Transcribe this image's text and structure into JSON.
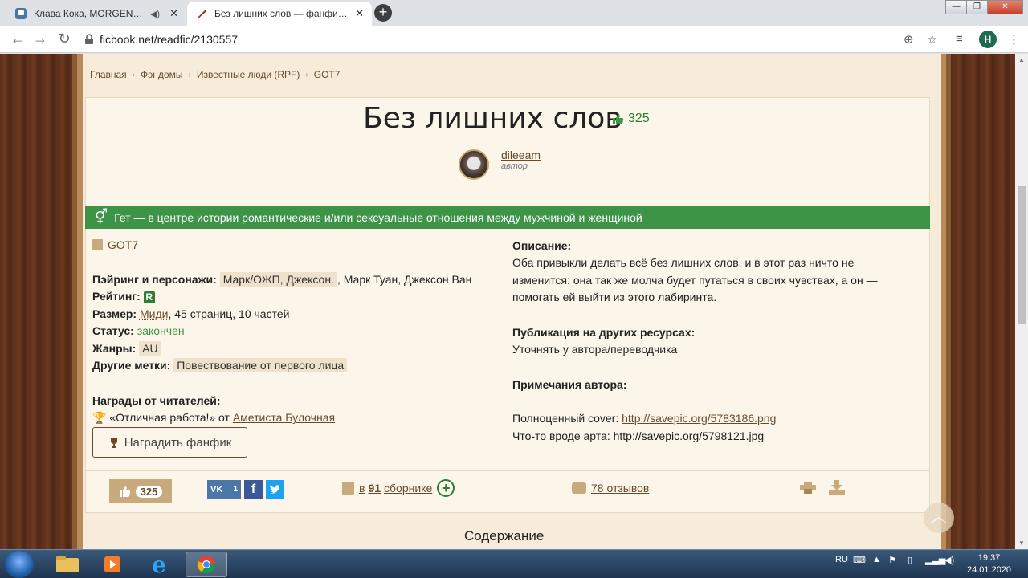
{
  "browser": {
    "tabs": [
      {
        "title": "Клава Кока, MORGENSHTERN",
        "active": false
      },
      {
        "title": "Без лишних слов — фанфик по",
        "active": true
      }
    ],
    "url": "ficbook.net/readfic/2130557",
    "profile_initial": "H"
  },
  "breadcrumbs": [
    "Главная",
    "Фэндомы",
    "Известные люди (RPF)",
    "GOT7"
  ],
  "fic": {
    "title": "Без лишних слов",
    "likes": "325",
    "author": {
      "name": "dileeam",
      "role": "автор"
    },
    "direction": "Гет — в центре истории романтические и/или сексуальные отношения между мужчиной и женщиной",
    "fandom": "GOT7",
    "pairing_label": "Пэйринг и персонажи:",
    "pairing_tag": "Марк/ОЖП, Джексон.",
    "pairing_rest": ", Марк Туан, Джексон Ван",
    "rating_label": "Рейтинг:",
    "rating": "R",
    "size_label": "Размер:",
    "size_link": "Миди",
    "size_rest": ", 45 страниц, 10 частей",
    "status_label": "Статус:",
    "status": "закончен",
    "genres_label": "Жанры:",
    "genre": "AU",
    "tags_label": "Другие метки:",
    "tag": "Повествование от первого лица",
    "awards_label": "Награды от читателей:",
    "award_text": "«Отличная работа!» от",
    "award_from": "Аметиста Булочная",
    "award_button": "Наградить фанфик",
    "description_label": "Описание:",
    "description": "Оба привыкли делать всё без лишних слов, и в этот раз ничто не изменится: она так же молча будет путаться в своих чувствах, а он — помогать ей выйти из этого лабиринта.",
    "publication_label": "Публикация на других ресурсах:",
    "publication": "Уточнять у автора/переводчика",
    "notes_label": "Примечания автора:",
    "notes_cover_label": "Полноценный cover:",
    "notes_cover_link": "http://savepic.org/5783186.png",
    "notes_art": "Что-то вроде арта: http://savepic.org/5798121.jpg"
  },
  "stats": {
    "likes": "325",
    "vk_count": "1",
    "collections_prefix": "в",
    "collections_count": "91",
    "collections_suffix": "сборнике",
    "reviews": "78 отзывов"
  },
  "contents_heading": "Содержание",
  "taskbar": {
    "lang": "RU",
    "time": "19:37",
    "date": "24.01.2020"
  },
  "colors": {
    "accent_green": "#3d9447",
    "link_brown": "#6b4a2b",
    "paper": "#f7ecd9"
  }
}
